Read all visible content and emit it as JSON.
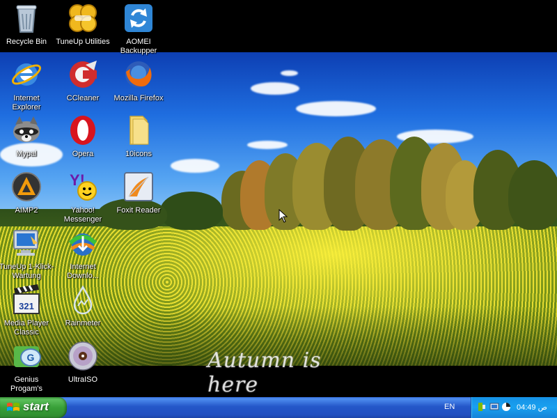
{
  "desktop": {
    "wallpaper_caption": "Autumn is here",
    "icons": [
      {
        "label": "Recycle Bin"
      },
      {
        "label": "TuneUp Utilities"
      },
      {
        "label": "AOMEI Backupper"
      },
      {
        "label": "Internet Explorer"
      },
      {
        "label": "CCleaner"
      },
      {
        "label": "Mozilla Firefox"
      },
      {
        "label": "Mypal"
      },
      {
        "label": "Opera"
      },
      {
        "label": "10icons"
      },
      {
        "label": "AIMP2"
      },
      {
        "label": "Yahoo! Messenger"
      },
      {
        "label": "Foxit Reader"
      },
      {
        "label": "TuneUp 1-Klick-Wartung"
      },
      {
        "label": "Internet Downlo..."
      },
      {
        "label": "Media Player Classic"
      },
      {
        "label": "Rainmeter"
      },
      {
        "label": "Genius Progam's"
      },
      {
        "label": "UltraISO"
      }
    ]
  },
  "taskbar": {
    "start_label": "start",
    "language": "EN",
    "clock": "04:49 ص"
  },
  "colors": {
    "taskbar_blue": "#2457c9",
    "start_green": "#38a038",
    "tray_blue": "#19a0ef"
  }
}
